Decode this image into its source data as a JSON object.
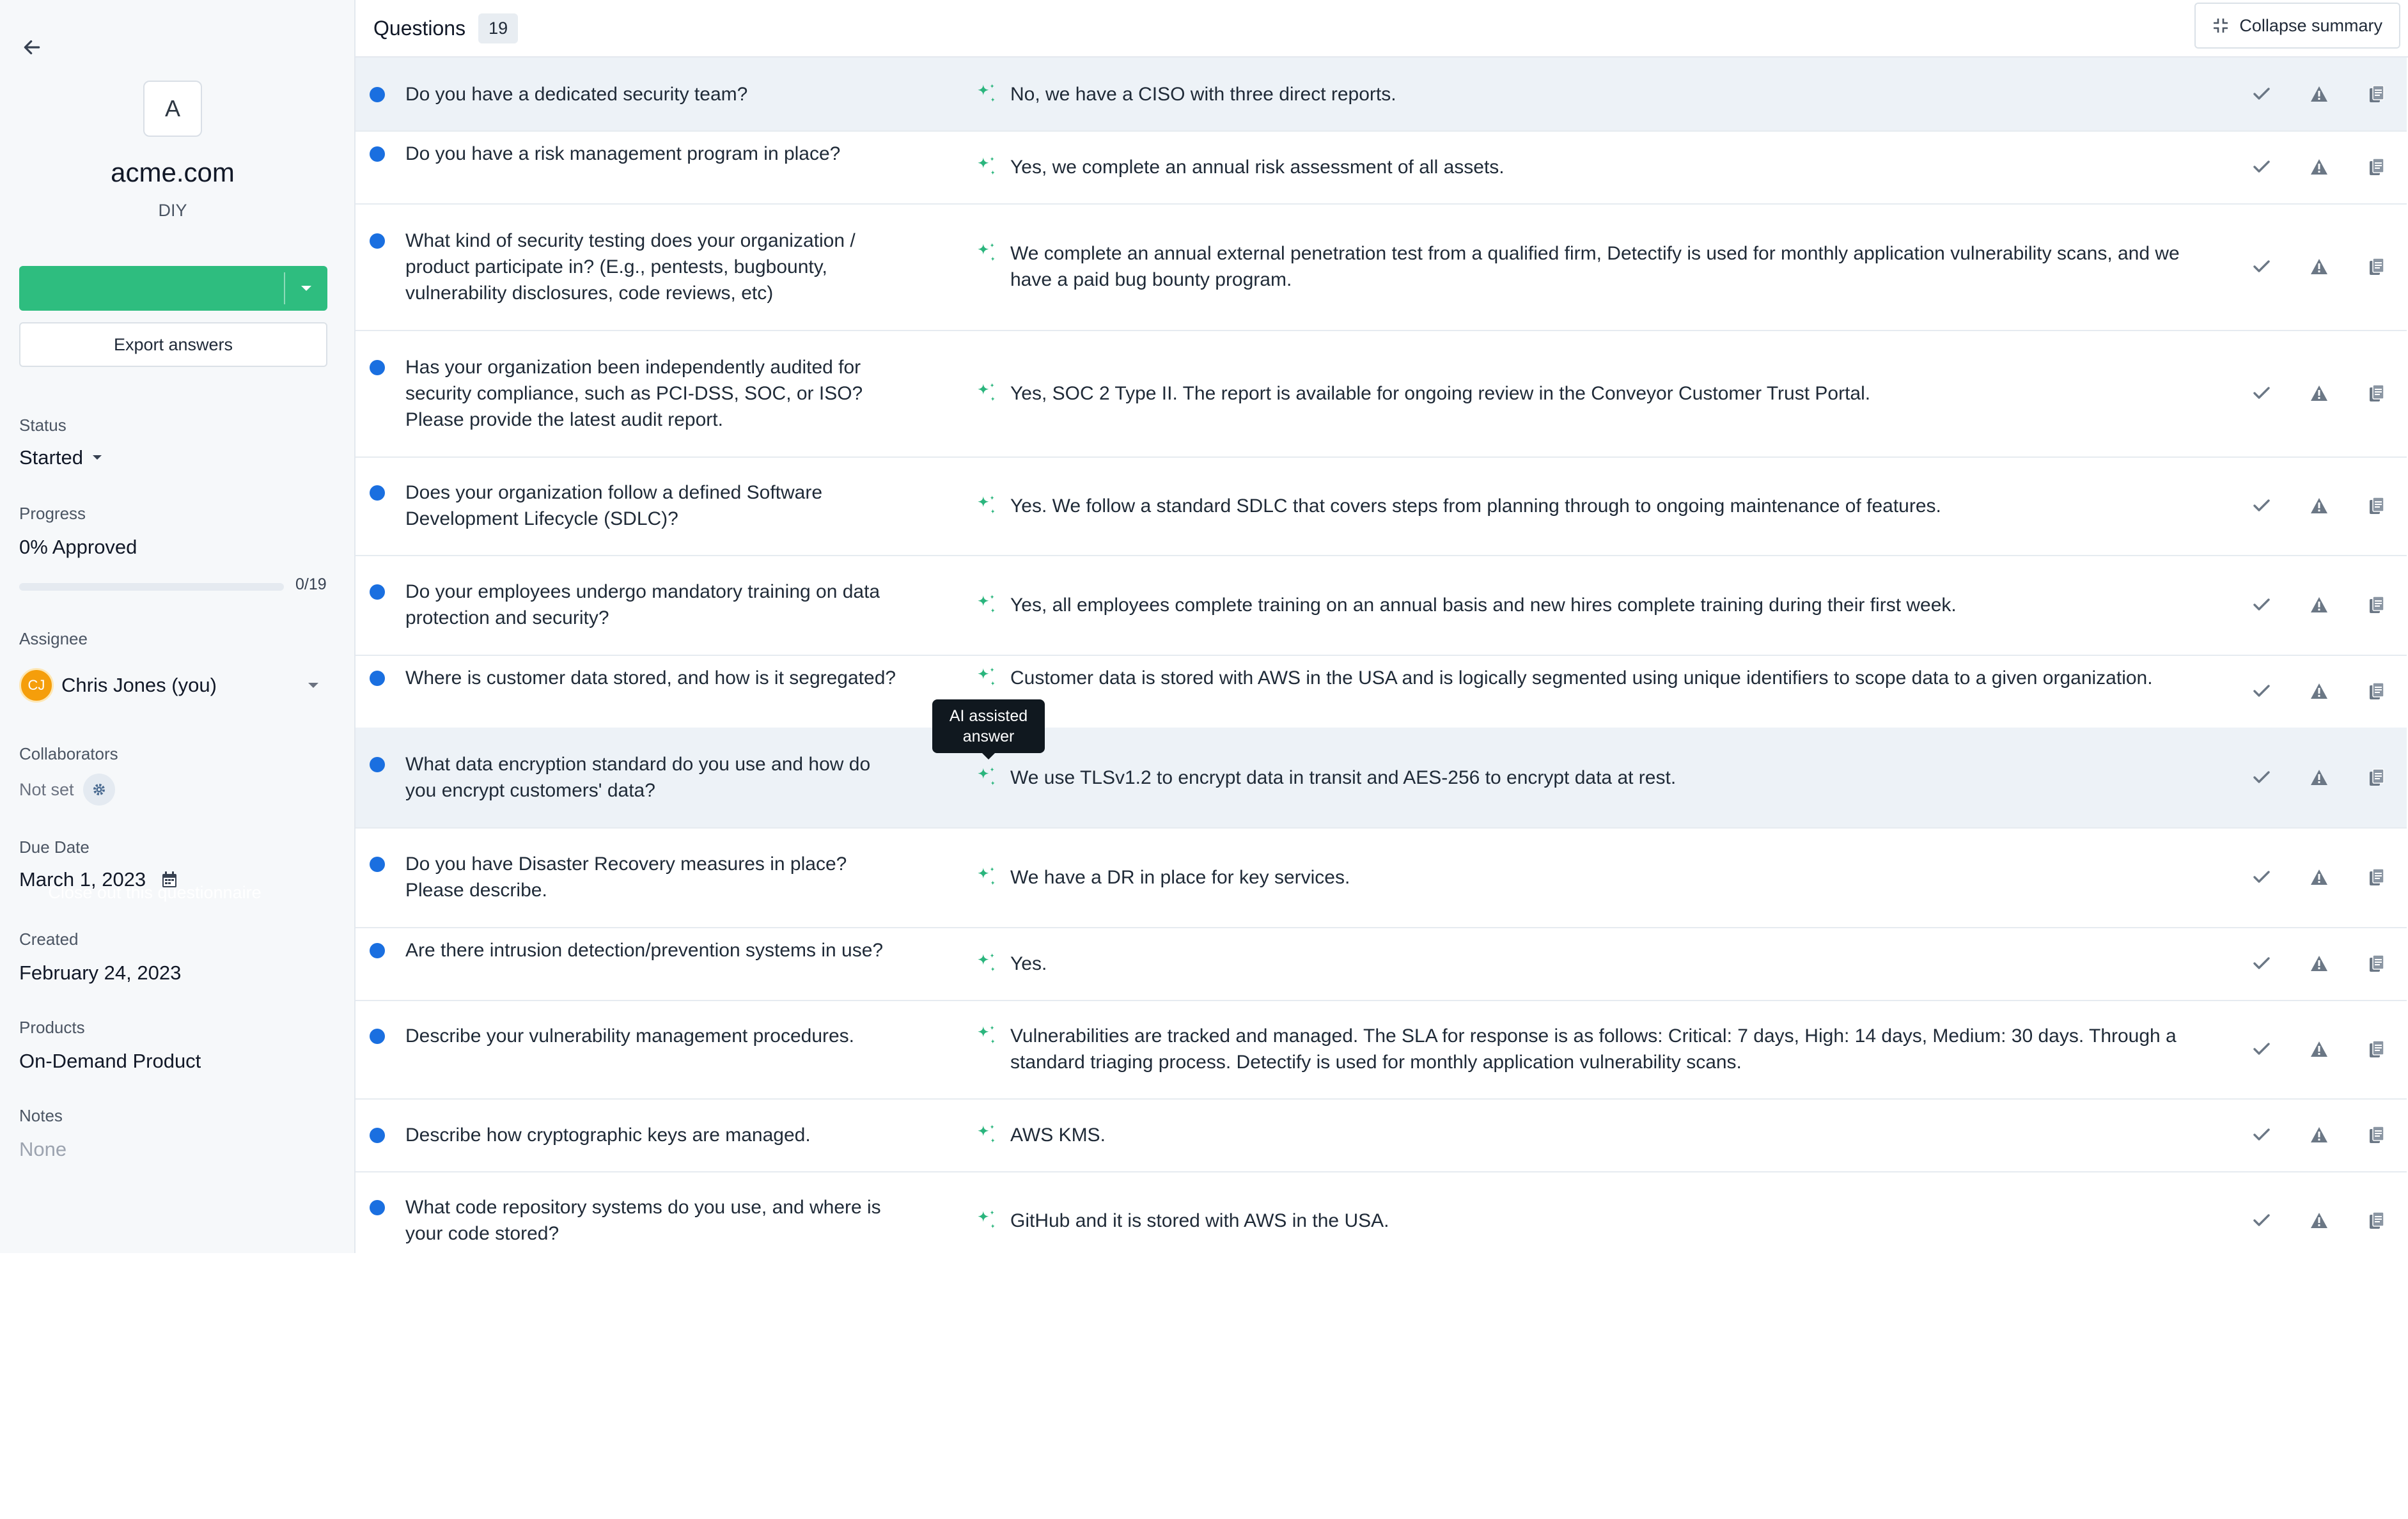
{
  "sidebar": {
    "company": {
      "logo_letter": "A",
      "name": "acme.com",
      "subtitle": "DIY"
    },
    "close_button": "Close out this questionnaire",
    "export_button": "Export answers",
    "status": {
      "label": "Status",
      "value": "Started"
    },
    "progress": {
      "label": "Progress",
      "value": "0% Approved",
      "count": "0/19",
      "fraction": 0
    },
    "assignee": {
      "label": "Assignee",
      "initials": "CJ",
      "name": "Chris Jones (you)"
    },
    "collaborators": {
      "label": "Collaborators",
      "value": "Not set"
    },
    "due_date": {
      "label": "Due Date",
      "value": "March 1, 2023"
    },
    "created": {
      "label": "Created",
      "value": "February 24, 2023"
    },
    "products": {
      "label": "Products",
      "value": "On-Demand Product"
    },
    "notes": {
      "label": "Notes",
      "value": "None"
    }
  },
  "header": {
    "title": "Questions",
    "count": "19",
    "collapse_button": "Collapse summary"
  },
  "tooltip": "AI assisted answer",
  "colors": {
    "accent_green": "#2ebd7f",
    "dot_blue": "#1a6fe0",
    "highlight_row": "#edf2f7",
    "sparkle": "#2ab57d"
  },
  "questions": [
    {
      "q": "Do you have a dedicated security team?",
      "a": "No, we have a CISO with three direct reports."
    },
    {
      "q": "Do you have a risk management program in place?",
      "a": "Yes, we complete an annual risk assessment of all assets."
    },
    {
      "q": "What kind of security testing does your organization / product participate in? (E.g., pentests, bugbounty, vulnerability disclosures, code reviews, etc)",
      "a": "We complete an annual external penetration test from a qualified firm, Detectify is used for monthly application vulnerability scans, and we have a paid bug bounty program."
    },
    {
      "q": "Has your organization been independently audited for security compliance, such as PCI-DSS, SOC, or ISO? Please provide the latest audit report.",
      "a": "Yes, SOC 2 Type II. The report is available for ongoing review in the Conveyor Customer Trust Portal."
    },
    {
      "q": "Does your organization follow a defined Software Development Lifecycle (SDLC)?",
      "a": "Yes. We follow a standard SDLC that covers steps from planning through to ongoing maintenance of features."
    },
    {
      "q": "Do your employees undergo mandatory training on data protection and security?",
      "a": "Yes, all employees complete training on an annual basis and new hires complete training during their first week."
    },
    {
      "q": "Where is customer data stored, and how is it segregated?",
      "a": "Customer data is stored with AWS in the USA and is logically segmented using unique identifiers to scope data to a given organization."
    },
    {
      "q": "What data encryption standard do you use and how do you encrypt customers' data?",
      "a": "We use TLSv1.2 to encrypt data in transit and AES-256 to encrypt data at rest."
    },
    {
      "q": "Do you have Disaster Recovery measures in place? Please describe.",
      "a": "We have a DR in place for key services."
    },
    {
      "q": "Are there intrusion detection/prevention systems in use?",
      "a": "Yes."
    },
    {
      "q": "Describe your vulnerability management procedures.",
      "a": "Vulnerabilities are tracked and managed. The SLA for response is as follows: Critical: 7 days, High: 14 days, Medium: 30 days. Through a standard triaging process. Detectify is used for monthly application vulnerability scans."
    },
    {
      "q": "Describe how cryptographic keys are managed.",
      "a": "AWS KMS."
    },
    {
      "q": "What code repository systems do you use, and where is your code stored?",
      "a": "GitHub and it is stored with AWS in the USA."
    }
  ]
}
